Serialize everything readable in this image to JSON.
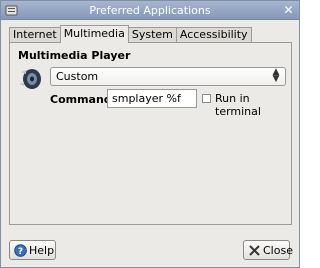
{
  "window": {
    "title": "Preferred Applications"
  },
  "tabs": [
    {
      "label": "Internet"
    },
    {
      "label": "Multimedia"
    },
    {
      "label": "System"
    },
    {
      "label": "Accessibility"
    }
  ],
  "multimedia": {
    "section_title": "Multimedia Player",
    "player_selected": "Custom",
    "command_label": "Command:",
    "command_value": "smplayer %f",
    "run_in_terminal_label": "Run in terminal",
    "run_in_terminal_checked": false
  },
  "buttons": {
    "help_label": "Help",
    "close_label": "Close"
  },
  "icons": {
    "title": "app-icon",
    "window_close": "close-icon",
    "player": "speaker-icon",
    "help": "help-icon",
    "close": "close-x-icon"
  },
  "colors": {
    "titlebar": "#8598b8",
    "window_bg": "#eceae6"
  }
}
